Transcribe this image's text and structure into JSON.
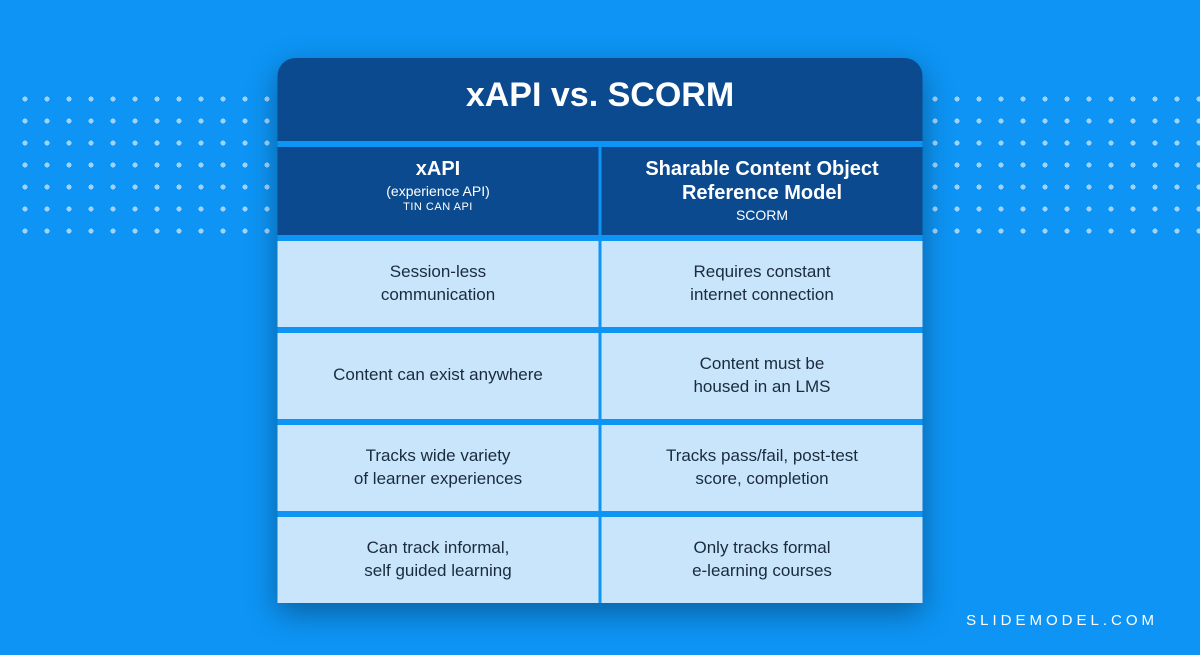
{
  "slide": {
    "title": "xAPI vs. SCORM",
    "columns": {
      "left": {
        "name": "xAPI",
        "subtitle": "(experience API)",
        "tag": "TIN CAN API"
      },
      "right": {
        "name": "Sharable Content Object Reference Model",
        "subtitle": "SCORM",
        "tag": ""
      }
    },
    "rows": [
      {
        "left": "Session-less\ncommunication",
        "right": "Requires constant\ninternet connection"
      },
      {
        "left": "Content can exist anywhere",
        "right": "Content must be\nhoused in an LMS"
      },
      {
        "left": "Tracks wide variety\nof learner experiences",
        "right": "Tracks pass/fail, post-test\nscore, completion"
      },
      {
        "left": "Can track informal,\nself guided learning",
        "right": "Only tracks formal\ne-learning courses"
      }
    ],
    "attribution": "SLIDEMODEL.COM"
  }
}
